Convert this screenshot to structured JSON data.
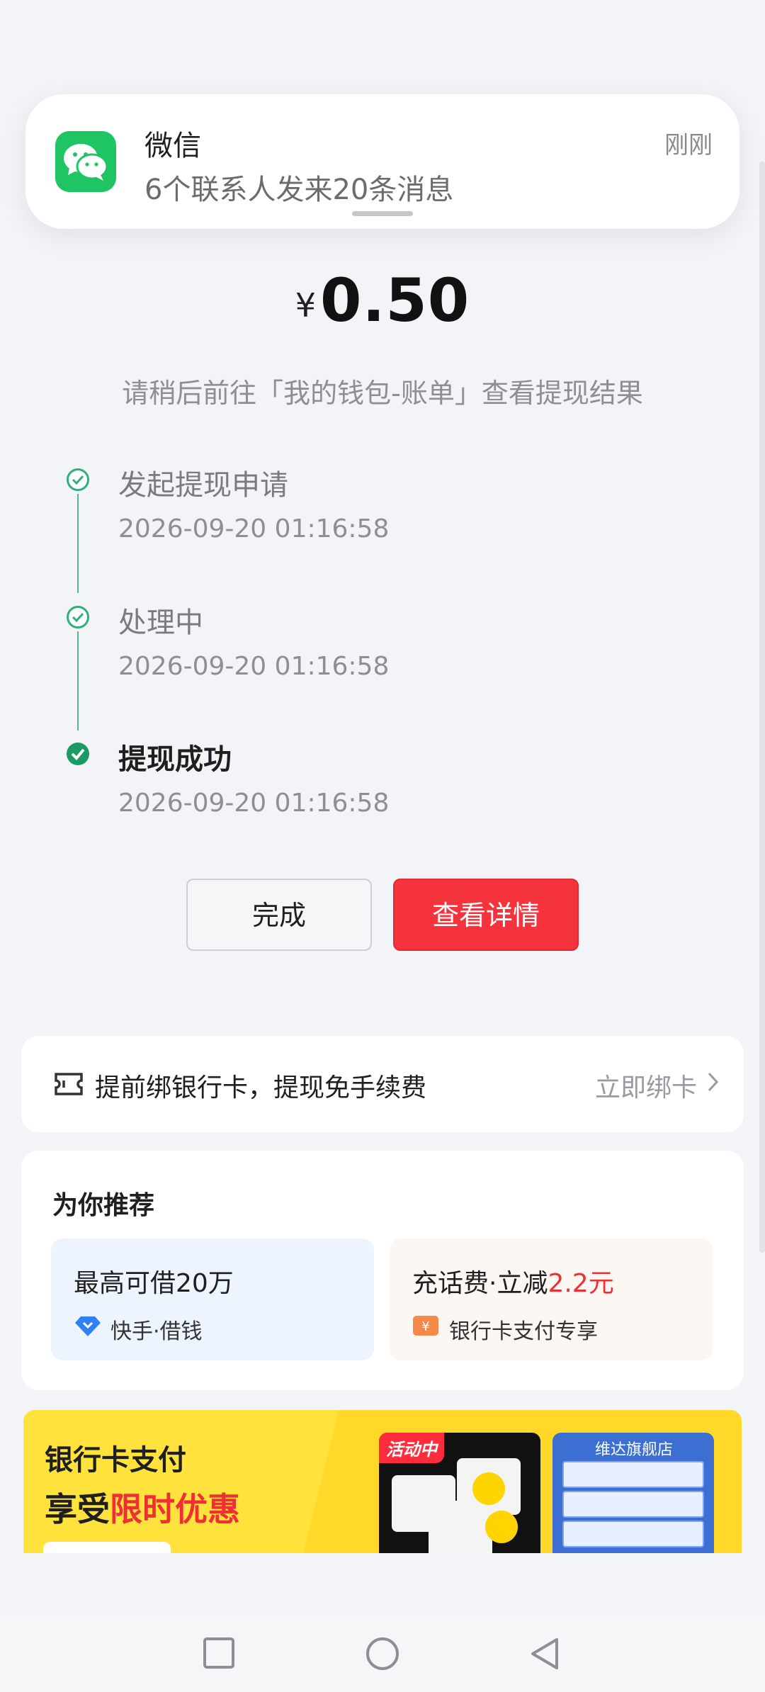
{
  "notification": {
    "app_name": "微信",
    "message": "6个联系人发来20条消息",
    "time": "刚刚",
    "icon": "wechat-icon",
    "accent": "#1fc463"
  },
  "amount": {
    "currency": "¥",
    "value": "0.50"
  },
  "hint": "请稍后前往「我的钱包-账单」查看提现结果",
  "steps": [
    {
      "title": "发起提现申请",
      "time": "2026-09-20 01:16:58",
      "state": "completed"
    },
    {
      "title": "处理中",
      "time": "2026-09-20 01:16:58",
      "state": "completed"
    },
    {
      "title": "提现成功",
      "time": "2026-09-20 01:16:58",
      "state": "current"
    }
  ],
  "buttons": {
    "done": "完成",
    "detail": "查看详情",
    "detail_color": "#f5333d"
  },
  "bind_card": {
    "text": "提前绑银行卡，提现免手续费",
    "action": "立即绑卡",
    "icon": "ticket-icon"
  },
  "recommend": {
    "title": "为你推荐",
    "cards": [
      {
        "title": "最高可借20万",
        "title_highlight": "",
        "sub": "快手·借钱",
        "icon": "diamond-icon"
      },
      {
        "title": "充话费·立减",
        "title_highlight": "2.2元",
        "sub": "银行卡支付专享",
        "icon": "yen-ticket-icon"
      }
    ]
  },
  "banner": {
    "line1": "银行卡支付",
    "line2_prefix": "享受",
    "line2_highlight": "限时优惠",
    "product1_tag": "活动中",
    "product2_tag": "维达旗舰店"
  },
  "navbar": {
    "icons": [
      "recents-square-icon",
      "home-circle-icon",
      "back-triangle-icon"
    ]
  }
}
